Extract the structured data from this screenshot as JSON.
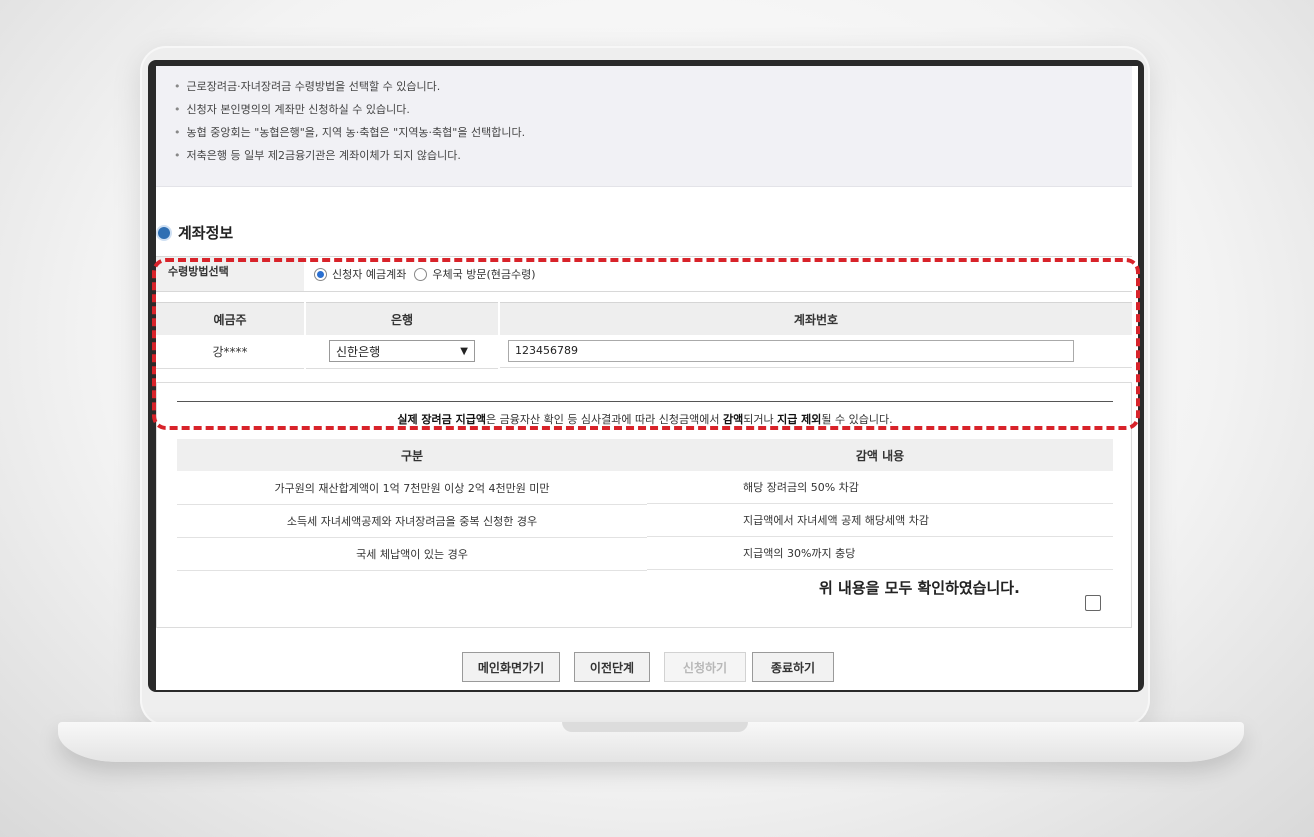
{
  "notices": [
    "근로장려금·자녀장려금 수령방법을 선택할 수 있습니다.",
    "신청자 본인명의의 계좌만 신청하실 수 있습니다.",
    "농협 중앙회는 \"농협은행\"을, 지역 농·축협은 \"지역농·축협\"을 선택합니다.",
    "저축은행 등 일부 제2금융기관은 계좌이체가 되지 않습니다."
  ],
  "section_title": "계좌정보",
  "method": {
    "label": "수령방법선택",
    "options": [
      "신청자 예금계좌",
      "우체국 방문(현금수령)"
    ],
    "selected_index": 0
  },
  "account": {
    "headers": [
      "예금주",
      "은행",
      "계좌번호"
    ],
    "holder": "강****",
    "bank_selected": "신한은행",
    "account_number": "123456789"
  },
  "deduction": {
    "notice_parts": [
      {
        "text": "실제 장려금 지급액",
        "bold": true
      },
      {
        "text": "은 금융자산 확인 등 심사결과에 따라 신청금액에서 ",
        "bold": false
      },
      {
        "text": "감액",
        "bold": true
      },
      {
        "text": "되거나 ",
        "bold": false
      },
      {
        "text": "지급 제외",
        "bold": true
      },
      {
        "text": "될 수 있습니다.",
        "bold": false
      }
    ],
    "headers": [
      "구분",
      "감액 내용"
    ],
    "rows": [
      [
        "가구원의 재산합계액이 1억 7천만원 이상 2억 4천만원 미만",
        "해당 장려금의 50% 차감"
      ],
      [
        "소득세 자녀세액공제와 자녀장려금을 중복 신청한 경우",
        "지급액에서 자녀세액 공제 해당세액 차감"
      ],
      [
        "국세 체납액이 있는 경우",
        "지급액의 30%까지 충당"
      ]
    ],
    "confirm_text": "위 내용을 모두 확인하였습니다.",
    "confirmed": false
  },
  "buttons": {
    "main": "메인화면가기",
    "prev": "이전단계",
    "apply": "신청하기",
    "exit": "종료하기"
  },
  "colors": {
    "highlight": "#d8232a",
    "radio_selected": "#2a6fd0",
    "section_bullet": "#2f6fb3"
  },
  "icons": [
    "section-bullet-icon",
    "chevron-down-icon",
    "checkbox-icon"
  ]
}
